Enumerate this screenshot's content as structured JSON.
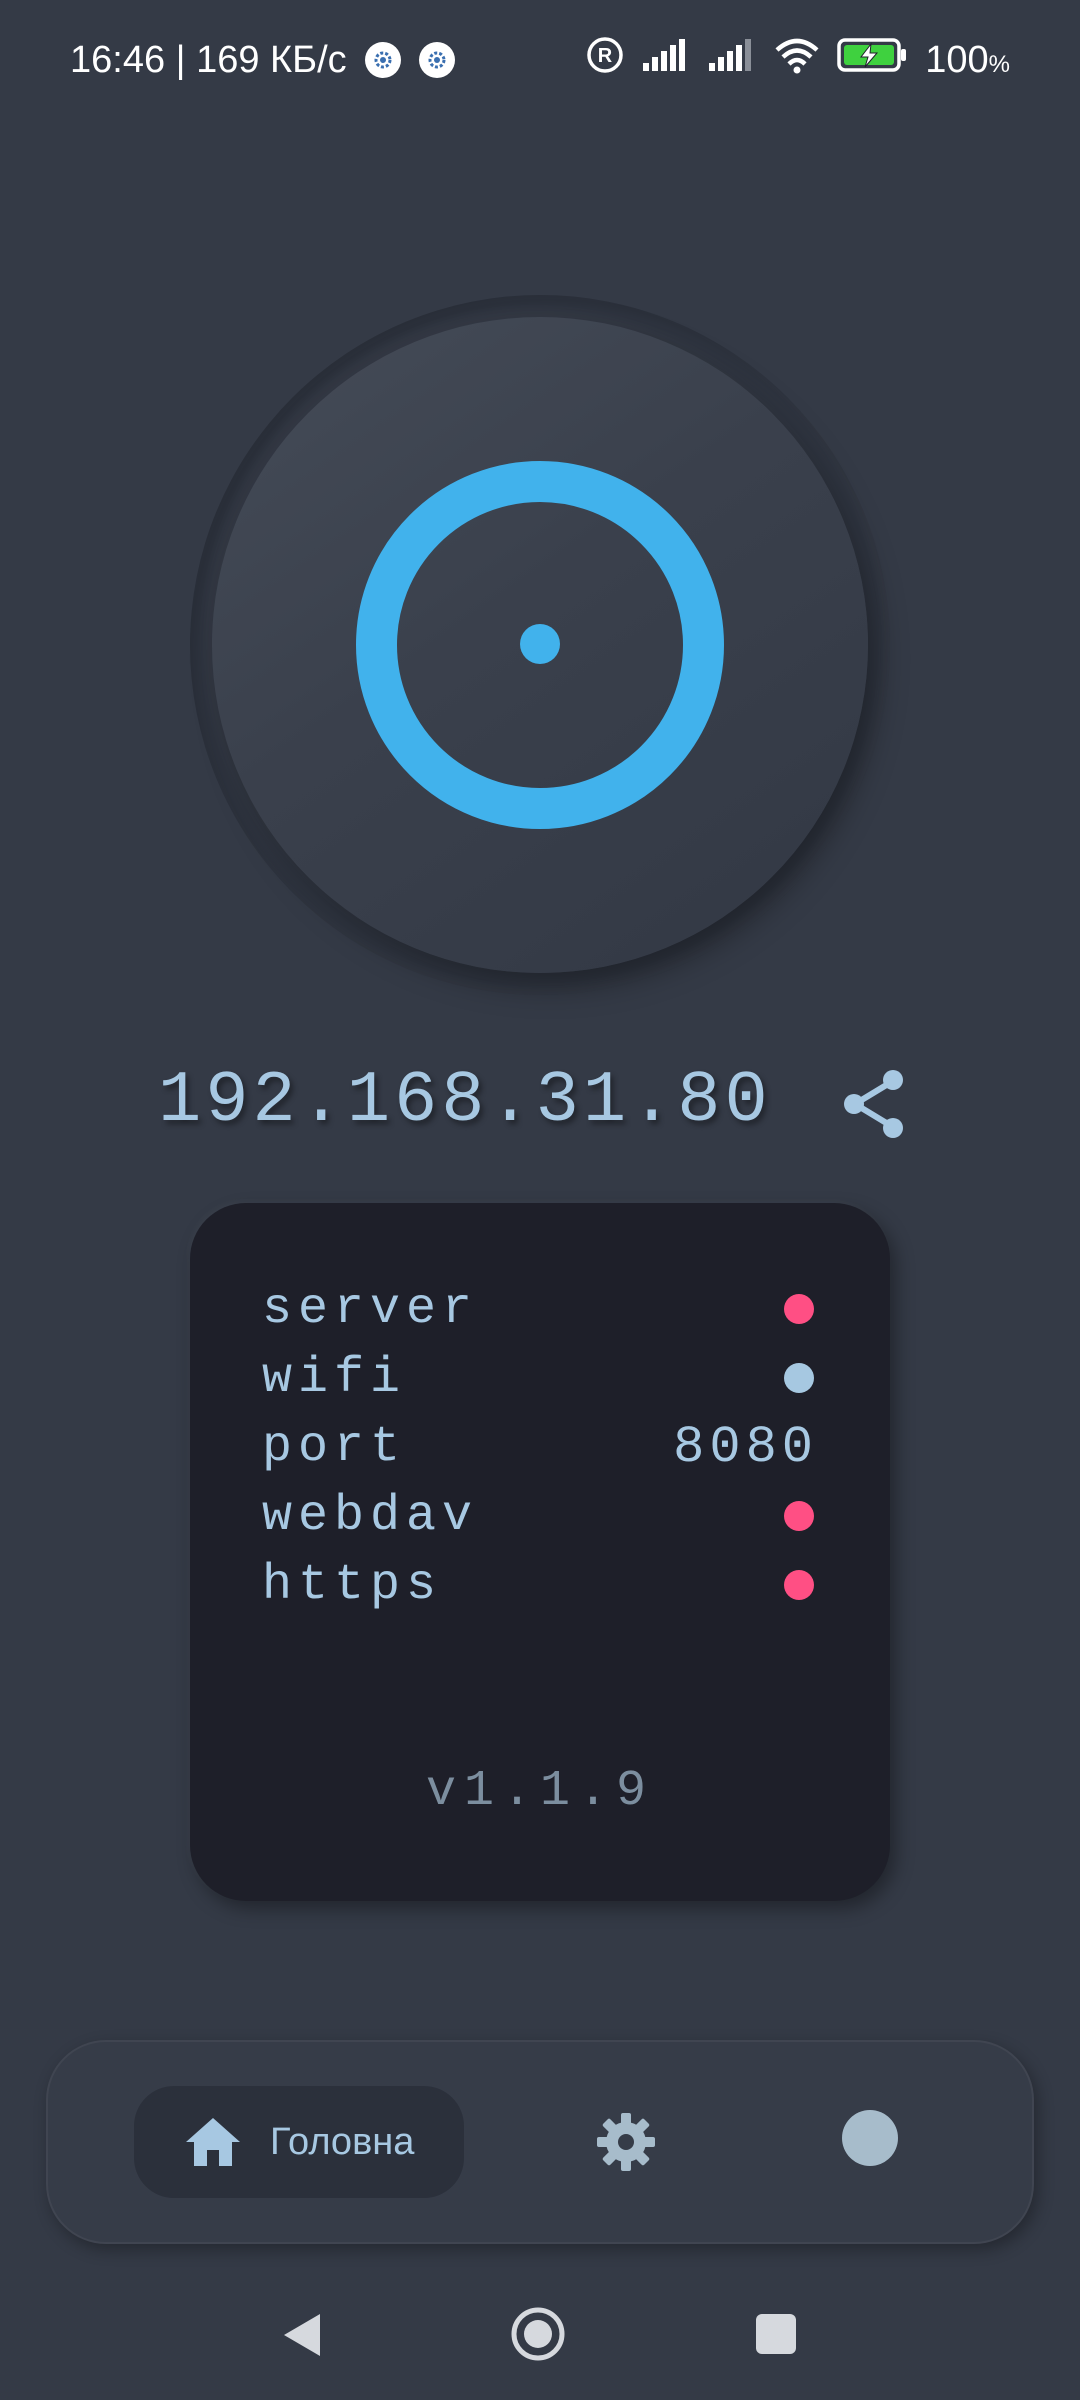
{
  "status_bar": {
    "time_speed": "16:46 | 169 КБ/с",
    "icons": [
      "settings-badge-icon",
      "settings-badge-icon",
      "roaming-icon",
      "signal-icon",
      "signal-icon",
      "wifi-icon",
      "battery-charging-icon"
    ],
    "battery_percent": "100",
    "battery_percent_sign": "%"
  },
  "power_button": {
    "icon": "power-ring-icon",
    "state": "on",
    "accent": "#41b2ec"
  },
  "address": {
    "ip": "192.168.31.80",
    "share_icon": "share-icon"
  },
  "status_card": {
    "rows": [
      {
        "label": "server",
        "indicator": "#ff4f84"
      },
      {
        "label": "wifi",
        "indicator": "#a6c8e1"
      },
      {
        "label": "port",
        "value": "8080"
      },
      {
        "label": "webdav",
        "indicator": "#ff4f84"
      },
      {
        "label": "https",
        "indicator": "#ff4f84"
      }
    ],
    "version": "v1.1.9"
  },
  "bottom_nav": {
    "home_label": "Головна",
    "home_icon": "home-icon",
    "settings_icon": "gear-icon",
    "third_icon": "circle-icon",
    "active": "home"
  },
  "system_nav": {
    "buttons": [
      "back-icon",
      "home-circle-icon",
      "recent-apps-icon"
    ]
  }
}
